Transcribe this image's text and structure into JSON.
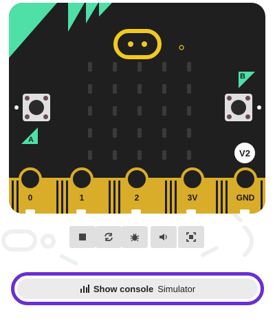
{
  "board": {
    "version_badge": "V2",
    "button_a_label": "A",
    "button_b_label": "B",
    "pins": [
      "0",
      "1",
      "2",
      "3V",
      "GND"
    ]
  },
  "toolbar": {
    "buttons": [
      {
        "icon": "stop-icon"
      },
      {
        "icon": "restart-icon"
      },
      {
        "icon": "debug-icon"
      },
      {
        "icon": "sound-icon"
      },
      {
        "icon": "fullscreen-icon"
      }
    ]
  },
  "console": {
    "show_label": "Show console",
    "context_label": "Simulator",
    "accent": "#6a2fd0"
  },
  "colors": {
    "board": "#1f1f1f",
    "gold": "#d9ad29",
    "green": "#4ee0a6"
  }
}
